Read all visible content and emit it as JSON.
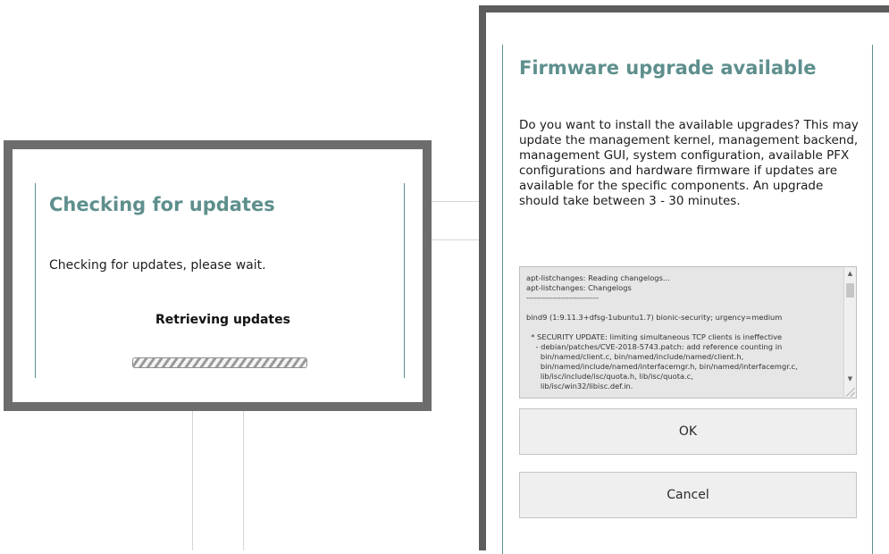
{
  "checking_dialog": {
    "title": "Checking for updates",
    "message": "Checking for updates, please wait.",
    "status": "Retrieving updates",
    "progress_fraction": 1.0
  },
  "upgrade_dialog": {
    "title": "Firmware upgrade available",
    "body": "Do you want to install the available upgrades? This may update the management kernel, management backend, management GUI, system configuration, available PFX configurations and hardware firmware if updates are available for the specific components. An upgrade should take between 3 - 30 minutes.",
    "log_lines": [
      "apt-listchanges: Reading changelogs...",
      "apt-listchanges: Changelogs",
      "---------------------------",
      "",
      "bind9 (1:9.11.3+dfsg-1ubuntu1.7) bionic-security; urgency=medium",
      "",
      "  * SECURITY UPDATE: limiting simultaneous TCP clients is ineffective",
      "    - debian/patches/CVE-2018-5743.patch: add reference counting in",
      "      bin/named/client.c, bin/named/include/named/client.h,",
      "      bin/named/include/named/interfacemgr.h, bin/named/interfacemgr.c,",
      "      lib/isc/include/isc/quota.h, lib/isc/quota.c,",
      "      lib/isc/win32/libisc.def.in."
    ],
    "ok_label": "OK",
    "cancel_label": "Cancel"
  },
  "icons": {
    "scroll_up": "scroll-up-arrow-icon",
    "scroll_down": "scroll-down-arrow-icon",
    "resize": "resize-grip-icon"
  },
  "colors": {
    "title_teal": "#5e8f8d",
    "dialog_frame": "#6d6d6d",
    "button_bg": "#efefef"
  }
}
